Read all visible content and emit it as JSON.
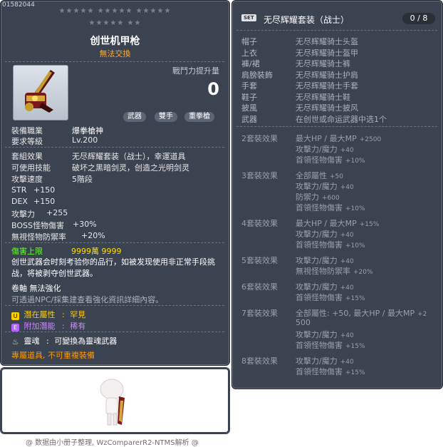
{
  "item": {
    "id": "01582044",
    "stars_row1": "★★★★★ ★★★★★ ★★★★★",
    "stars_row2": "★★★★★ ★★",
    "name": "创世机甲枪",
    "trade": "無法交換",
    "power_label": "戰鬥力提升量",
    "power_value": "0",
    "tags": [
      "武器",
      "雙手",
      "重拳槍"
    ],
    "job_label": "裝備職業",
    "job_value": "爆拳槍神",
    "level_label": "要求等級",
    "level_value": "Lv.200",
    "set_label": "套組效果",
    "set_value": "无尽辉耀套装（战士），幸運道具",
    "skill_label": "可使用技能",
    "skill_value": "破坏之黑暗剑灵，创造之光明剑灵",
    "speed_label": "攻擊速度",
    "speed_value": "5階段",
    "str_label": "STR",
    "str_value": "+150",
    "dex_label": "DEX",
    "dex_value": "+150",
    "atk_label": "攻擊力",
    "atk_value": "+255",
    "boss_label": "BOSS怪物傷害",
    "boss_value": "+30%",
    "ignore_label": "無視怪物防禦率",
    "ignore_value": "+20%",
    "damage_cap_label": "傷害上限",
    "damage_cap_value": "9999萬 9999",
    "desc": "创世武器会时刻考验你的品行，如被发现使用非正常手段挑战，将被剥夺创世武器。",
    "scroll_text": "卷軸 無法強化",
    "npc_text": "可透過NPC/採集建查看強化資訊詳細內容。",
    "potential_label": "潛在屬性",
    "potential_value": "罕見",
    "add_potential_label": "附加潛能",
    "add_potential_value": "稀有",
    "soul_label": "靈魂",
    "soul_value": "可變換為靈魂武器",
    "exclusive": "專屬道具, 不可重複裝備"
  },
  "set": {
    "badge": "SET",
    "title": "无尽辉耀套装（战士）",
    "count": "0 / 8",
    "slots": [
      {
        "slot": "帽子",
        "name": "无尽辉耀骑士头盔"
      },
      {
        "slot": "上衣",
        "name": "无尽辉耀骑士盔甲"
      },
      {
        "slot": "褲/裙",
        "name": "无尽辉耀骑士裤"
      },
      {
        "slot": "肩膀裝飾",
        "name": "无尽辉耀骑士护肩"
      },
      {
        "slot": "手套",
        "name": "无尽辉耀骑士手套"
      },
      {
        "slot": "鞋子",
        "name": "无尽辉耀骑士鞋"
      },
      {
        "slot": "披風",
        "name": "无尽辉耀骑士披风"
      },
      {
        "slot": "武器",
        "name": "在创世或命运武器中选1个"
      }
    ],
    "effects": [
      {
        "head": "2套裝效果",
        "lines": [
          [
            "最大HP / 最大MP",
            "+2500"
          ],
          [
            "攻擊力/魔力",
            "+40"
          ],
          [
            "首領怪物傷害",
            "+10%"
          ]
        ]
      },
      {
        "head": "3套裝效果",
        "lines": [
          [
            "全部屬性",
            "+50"
          ],
          [
            "攻擊力/魔力",
            "+40"
          ],
          [
            "防禦力",
            "+600"
          ],
          [
            "首領怪物傷害",
            "+10%"
          ]
        ]
      },
      {
        "head": "4套裝效果",
        "lines": [
          [
            "最大HP / 最大MP",
            "+15%"
          ],
          [
            "攻擊力/魔力",
            "+40"
          ],
          [
            "首領怪物傷害",
            "+10%"
          ]
        ]
      },
      {
        "head": "5套裝效果",
        "lines": [
          [
            "攻擊力/魔力",
            "+40"
          ],
          [
            "無視怪物防禦率",
            "+20%"
          ]
        ]
      },
      {
        "head": "6套裝效果",
        "lines": [
          [
            "攻擊力/魔力",
            "+40"
          ],
          [
            "首領怪物傷害",
            "+15%"
          ]
        ]
      },
      {
        "head": "7套裝效果",
        "lines": [
          [
            "全部屬性: +50, 最大HP / 最大MP",
            "+2"
          ],
          [
            "500",
            ""
          ],
          [
            "攻擊力/魔力",
            "+40"
          ],
          [
            "首領怪物傷害",
            "+15%"
          ]
        ]
      },
      {
        "head": "8套裝效果",
        "lines": [
          [
            "攻擊力/魔力",
            "+40"
          ],
          [
            "首領怪物傷害",
            "+15%"
          ]
        ]
      }
    ]
  },
  "footer": "@ 数据由小册子整理, WzComparerR2-NTMS解析 @",
  "colors": {
    "panel": "#3b4250",
    "potential": "#ffcc00",
    "green": "#66ff33",
    "orange": "#ff9900"
  }
}
